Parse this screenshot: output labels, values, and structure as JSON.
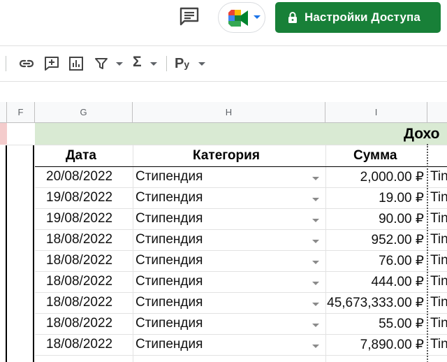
{
  "header": {
    "comment_icon": "comment-icon",
    "meet_icon": "google-meet-icon",
    "share_button_label": "Настройки Доступа",
    "share_icon": "lock-icon",
    "accent_color": "#188038"
  },
  "toolbar": {
    "icons": [
      "insert-link-icon",
      "insert-comment-icon",
      "insert-chart-icon",
      "filter-icon",
      "functions-icon"
    ],
    "sigma_label": "Σ",
    "currency_label": "Р",
    "currency_sub": "у"
  },
  "columns": {
    "f": "F",
    "g": "G",
    "h": "H",
    "i": "I"
  },
  "banner": {
    "title": "Дохо",
    "color": "#d9ead3"
  },
  "table": {
    "headers": {
      "date": "Дата",
      "category": "Категория",
      "amount": "Сумма"
    },
    "rows": [
      {
        "date": "20/08/2022",
        "category": "Стипендия",
        "amount": "2,000.00 ₽",
        "extra": "Tin"
      },
      {
        "date": "19/08/2022",
        "category": "Стипендия",
        "amount": "19.00 ₽",
        "extra": "Tin"
      },
      {
        "date": "19/08/2022",
        "category": "Стипендия",
        "amount": "90.00 ₽",
        "extra": "Tin"
      },
      {
        "date": "18/08/2022",
        "category": "Стипендия",
        "amount": "952.00 ₽",
        "extra": "Tin"
      },
      {
        "date": "18/08/2022",
        "category": "Стипендия",
        "amount": "76.00 ₽",
        "extra": "Tin"
      },
      {
        "date": "18/08/2022",
        "category": "Стипендия",
        "amount": "444.00 ₽",
        "extra": "Tin"
      },
      {
        "date": "18/08/2022",
        "category": "Стипендия",
        "amount": "45,673,333.00 ₽",
        "extra": "Tin"
      },
      {
        "date": "18/08/2022",
        "category": "Стипендия",
        "amount": "55.00 ₽",
        "extra": "Tin"
      },
      {
        "date": "18/08/2022",
        "category": "Стипендия",
        "amount": "7,890.00 ₽",
        "extra": "Tin"
      }
    ]
  }
}
